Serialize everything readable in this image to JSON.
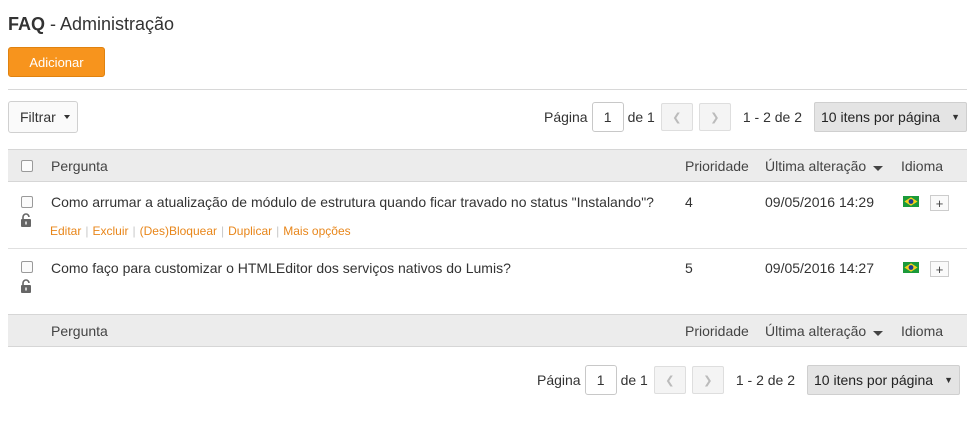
{
  "header": {
    "title_bold": "FAQ",
    "title_rest": " - Administração"
  },
  "toolbar": {
    "add_label": "Adicionar",
    "filter_label": "Filtrar"
  },
  "pager": {
    "page_label": "Página",
    "page_value": "1",
    "of_label": "de 1",
    "range": "1 - 2 de 2",
    "per_page": "10 itens por página"
  },
  "table": {
    "columns": {
      "question": "Pergunta",
      "priority": "Prioridade",
      "updated": "Última alteração",
      "language": "Idioma"
    },
    "rows": [
      {
        "question": "Como arrumar a atualização de módulo de estrutura quando ficar travado no status \"Instalando\"?",
        "priority": "4",
        "updated": "09/05/2016 14:29",
        "actions": [
          "Editar",
          "Excluir",
          "(Des)Bloquear",
          "Duplicar",
          "Mais opções"
        ]
      },
      {
        "question": "Como faço para customizar o HTMLEditor dos serviços nativos do Lumis?",
        "priority": "5",
        "updated": "09/05/2016 14:27"
      }
    ]
  },
  "colors": {
    "accent": "#f7941d",
    "action_link": "#e8861a",
    "header_bg": "#ececec"
  },
  "icons": [
    "checkbox-icon",
    "lock-icon",
    "brazil-flag-icon",
    "plus-icon",
    "chevron-left-icon",
    "chevron-right-icon",
    "caret-down-icon"
  ]
}
